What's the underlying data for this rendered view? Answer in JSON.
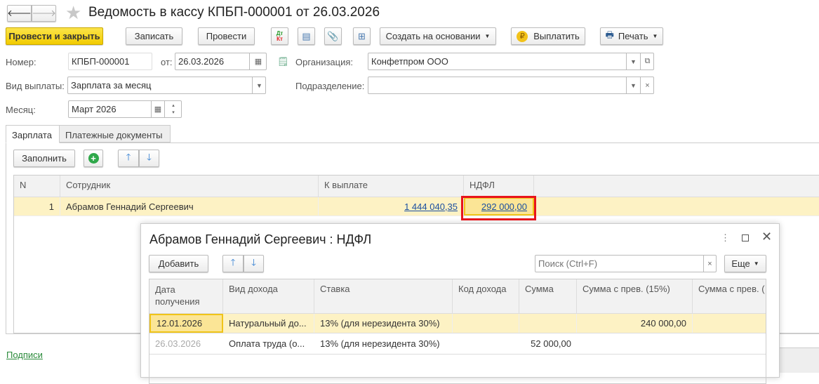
{
  "title": "Ведомость в кассу КПБП-000001 от 26.03.2026",
  "toolbar": {
    "post_close": "Провести и закрыть",
    "save": "Записать",
    "post": "Провести",
    "dt_kt": "Дт\nКт",
    "create_based": "Создать на основании",
    "pay": "Выплатить",
    "print": "Печать"
  },
  "form": {
    "number_label": "Номер:",
    "number": "КПБП-000001",
    "date_label": "от:",
    "date": "26.03.2026",
    "org_label": "Организация:",
    "org": "Конфетпром ООО",
    "pay_type_label": "Вид выплаты:",
    "pay_type": "Зарплата за месяц",
    "dept_label": "Подразделение:",
    "dept": "",
    "month_label": "Месяц:",
    "month": "Март 2026"
  },
  "tabs": [
    {
      "label": "Зарплата"
    },
    {
      "label": "Платежные документы"
    }
  ],
  "tab_toolbar": {
    "fill": "Заполнить"
  },
  "table": {
    "headers": [
      "N",
      "Сотрудник",
      "К выплате",
      "НДФЛ"
    ],
    "rows": [
      {
        "n": "1",
        "employee": "Абрамов Геннадий Сергеевич",
        "to_pay": "1 444 040,35",
        "ndfl": "292 000,00"
      }
    ]
  },
  "footer": {
    "signatures": "Подписи"
  },
  "popup": {
    "title": "Абрамов Геннадий Сергеевич : НДФЛ",
    "add": "Добавить",
    "search_placeholder": "Поиск (Ctrl+F)",
    "more": "Еще",
    "headers": [
      "Дата получения",
      "Вид дохода",
      "Ставка",
      "Код дохода",
      "Сумма",
      "Сумма с прев. (15%)",
      "Сумма с прев. ("
    ],
    "rows": [
      {
        "date": "12.01.2026",
        "type": "Натуральный до...",
        "rate": "13% (для нерезидента 30%)",
        "code": "",
        "sum": "",
        "sum15": "240 000,00",
        "sum_other": ""
      },
      {
        "date": "26.03.2026",
        "type": "Оплата труда (о...",
        "rate": "13% (для нерезидента 30%)",
        "code": "",
        "sum": "52 000,00",
        "sum15": "",
        "sum_other": ""
      }
    ]
  },
  "colors": {
    "accent": "#f2cb00",
    "highlight": "#fdf2c4",
    "annotation": "#e8141c"
  }
}
